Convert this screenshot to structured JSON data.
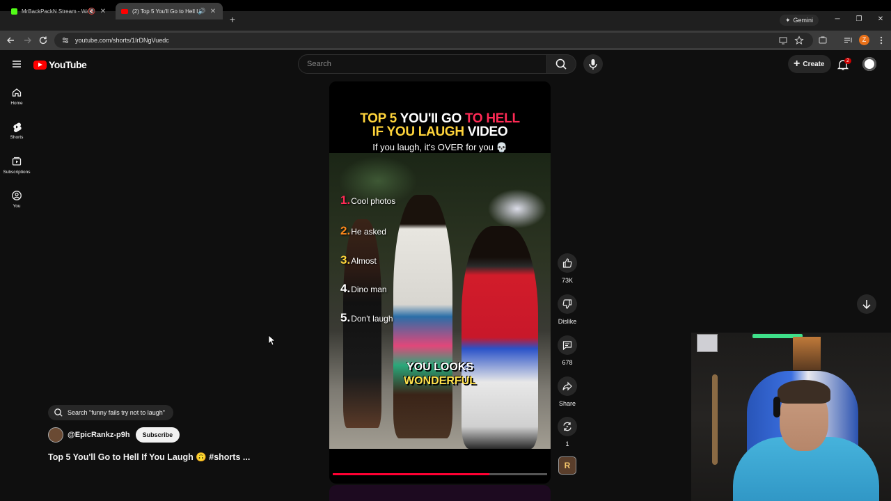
{
  "browser": {
    "tabs": [
      {
        "title": "MrBackPackN Stream - Wa",
        "active": false,
        "favicon_color": "#53fc18"
      },
      {
        "title": "(2) Top 5 You'll Go to Hell If",
        "active": true,
        "favicon_color": "#ff0000"
      }
    ],
    "gemini_label": "Gemini",
    "url": "youtube.com/shorts/1IrDNgVuedc",
    "profile_initial": "Z"
  },
  "masthead": {
    "logo_text": "YouTube",
    "search_placeholder": "Search",
    "create_label": "Create",
    "notification_count": "2"
  },
  "sidebar": {
    "items": [
      {
        "label": "Home",
        "icon": "home-icon"
      },
      {
        "label": "Shorts",
        "icon": "shorts-icon"
      },
      {
        "label": "Subscriptions",
        "icon": "subscriptions-icon"
      },
      {
        "label": "You",
        "icon": "you-icon"
      }
    ]
  },
  "short": {
    "headline_line1": [
      "TOP 5 ",
      "YOU'II GO ",
      "TO HELL"
    ],
    "headline_line2": [
      "IF YOU LAUGH ",
      "VIDEO"
    ],
    "subline": "If you laugh, it's OVER for you 💀",
    "ranking": [
      {
        "num": "1.",
        "label": "Cool photos",
        "color": "#ff2a55"
      },
      {
        "num": "2.",
        "label": "He asked",
        "color": "#ff8a1c"
      },
      {
        "num": "3.",
        "label": "Almost",
        "color": "#ffd43b"
      },
      {
        "num": "4.",
        "label": "Dino man",
        "color": "#ffffff"
      },
      {
        "num": "5.",
        "label": "Don't laugh",
        "color": "#ffffff"
      }
    ],
    "caption_line1": "YOU LOOKS",
    "caption_line2": "WONDERFUL",
    "progress": 0.73
  },
  "actions": {
    "like_count": "73K",
    "dislike_label": "Dislike",
    "comment_count": "678",
    "share_label": "Share",
    "remix_count": "1",
    "channel_badge": "R"
  },
  "meta": {
    "search_chip": "Search \"funny fails try not to laugh\"",
    "channel_name": "@EpicRankz-p9h",
    "subscribe_label": "Subscribe",
    "video_title": "Top 5 You'll Go to Hell If You Laugh 🙃 #shorts ..."
  },
  "colors": {
    "background": "#0f0f0f",
    "accent_red": "#ff0000",
    "text": "#f1f1f1"
  }
}
